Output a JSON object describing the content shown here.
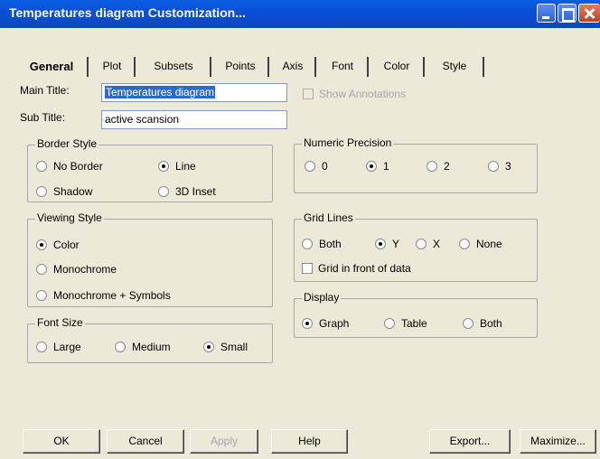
{
  "window": {
    "title": "Temperatures diagram Customization..."
  },
  "tabs": [
    "General",
    "Plot",
    "Subsets",
    "Points",
    "Axis",
    "Font",
    "Color",
    "Style"
  ],
  "fields": {
    "main_title_label": "Main Title:",
    "main_title_value": "Temperatures diagram",
    "sub_title_label": "Sub Title:",
    "sub_title_value": "active scansion",
    "show_annotations_label": "Show Annotations"
  },
  "border_style": {
    "label": "Border Style",
    "options": [
      "No Border",
      "Line",
      "Shadow",
      "3D Inset"
    ],
    "selected": "Line"
  },
  "viewing_style": {
    "label": "Viewing Style",
    "options": [
      "Color",
      "Monochrome",
      "Monochrome + Symbols"
    ],
    "selected": "Color"
  },
  "font_size": {
    "label": "Font Size",
    "options": [
      "Large",
      "Medium",
      "Small"
    ],
    "selected": "Small"
  },
  "numeric_precision": {
    "label": "Numeric Precision",
    "options": [
      "0",
      "1",
      "2",
      "3"
    ],
    "selected": "1"
  },
  "grid_lines": {
    "label": "Grid Lines",
    "options": [
      "Both",
      "Y",
      "X",
      "None"
    ],
    "selected": "Y",
    "front_label": "Grid in front of data"
  },
  "display": {
    "label": "Display",
    "options": [
      "Graph",
      "Table",
      "Both"
    ],
    "selected": "Graph"
  },
  "buttons": {
    "ok": "OK",
    "cancel": "Cancel",
    "apply": "Apply",
    "help": "Help",
    "export": "Export...",
    "maximize": "Maximize..."
  }
}
